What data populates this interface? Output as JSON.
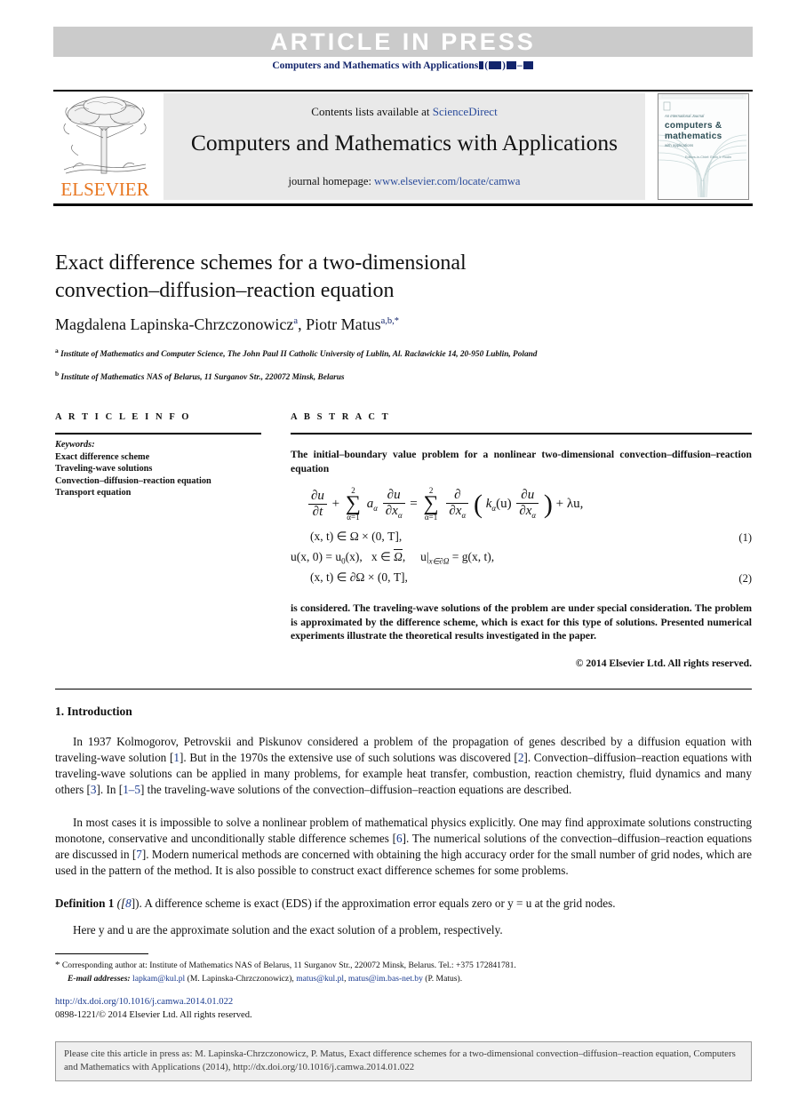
{
  "banner": {
    "text": "ARTICLE  IN  PRESS",
    "journal_ref_prefix": "Computers and Mathematics with Applications",
    "journal_ref_suffix": "( ) –"
  },
  "masthead": {
    "contents_prefix": "Contents lists available at ",
    "sciencedirect": "ScienceDirect",
    "journal_title": "Computers and Mathematics with Applications",
    "homepage_prefix": "journal homepage: ",
    "homepage_url": "www.elsevier.com/locate/camwa",
    "publisher": "ELSEVIER",
    "cover": {
      "line1": "An International Journal",
      "line2": "computers &",
      "line3": "mathematics",
      "line4": "with applications",
      "line5": "Editors-in-Chief: Ervin Y. Rodin"
    }
  },
  "article": {
    "title_line1": "Exact difference schemes for a two-dimensional",
    "title_line2": "convection–diffusion–reaction equation",
    "author1": "Magdalena Lapinska-Chrzczonowicz",
    "author1_sup": "a",
    "author2": "Piotr Matus",
    "author2_sup": "a,b,",
    "author2_star": "*",
    "affiliation_a_label": "a",
    "affiliation_a": "Institute of Mathematics and Computer Science, The John Paul II Catholic University of Lublin, Al. Raclawickie 14, 20-950 Lublin, Poland",
    "affiliation_b_label": "b",
    "affiliation_b": "Institute of Mathematics NAS of Belarus, 11 Surganov Str., 220072 Minsk, Belarus"
  },
  "info": {
    "heading": "A R T I C L E   I N F O",
    "keywords_label": "Keywords:",
    "keywords": [
      "Exact difference scheme",
      "Traveling-wave solutions",
      "Convection–diffusion–reaction equation",
      "Transport equation"
    ]
  },
  "abstract": {
    "heading": "A B S T R A C T",
    "intro": "The initial–boundary value problem for a nonlinear two-dimensional convection–diffusion–reaction equation",
    "tail": "is considered. The traveling-wave solutions of the problem are under special consideration. The problem is approximated by the difference scheme, which is exact for this type of solutions. Presented numerical experiments illustrate the theoretical results investigated in the paper.",
    "copyright": "© 2014 Elsevier Ltd. All rights reserved."
  },
  "equations": {
    "eq1_number": "(1)",
    "eq2_number": "(2)",
    "eq1_lhs_num": "∂u",
    "eq1_lhs_den": "∂t",
    "eq1_sum_upper": "2",
    "eq1_sum_lower": "α=1",
    "eq1_coeff": "a",
    "eq1_coeff_sub": "α",
    "eq1_du": "∂u",
    "eq1_dxa": "∂x",
    "eq1_dxa_sub": "α",
    "eq1_rhs_d": "∂",
    "eq1_k": "k",
    "eq1_k_sub": "α",
    "eq1_k_arg": "(u)",
    "eq1_lambda": "+ λu,",
    "eq1_domain": "(x, t) ∈ Ω × (0, T],",
    "eq2_init": "u(x, 0) = u",
    "eq2_init_sub": "0",
    "eq2_init_rest": "(x),",
    "eq2_xin": "x ∈",
    "eq2_omegabar": "Ω",
    "eq2_comma": ",",
    "eq2_bc": "u|",
    "eq2_bc_sub": "x∈∂Ω",
    "eq2_bc_rest": "= g(x, t),",
    "eq2_domain": "(x, t) ∈ ∂Ω × (0, T],"
  },
  "introduction": {
    "heading": "1. Introduction",
    "p1_a": "In 1937 Kolmogorov, Petrovskii and Piskunov considered a problem of the propagation of genes described by a diffusion equation with traveling-wave solution [",
    "p1_ref1": "1",
    "p1_b": "]. But in the 1970s the extensive use of such solutions was discovered [",
    "p1_ref2": "2",
    "p1_c": "]. Convection–diffusion–reaction equations with traveling-wave solutions can be applied in many problems, for example heat transfer, combustion, reaction chemistry, fluid dynamics and many others [",
    "p1_ref3": "3",
    "p1_d": "]. In [",
    "p1_ref4": "1–5",
    "p1_e": "] the traveling-wave solutions of the convection–diffusion–reaction equations are described.",
    "p2_a": "In most cases it is impossible to solve a nonlinear problem of mathematical physics explicitly. One may find approximate solutions constructing monotone, conservative and unconditionally stable difference schemes [",
    "p2_ref1": "6",
    "p2_b": "]. The numerical solutions of the convection–diffusion–reaction equations are discussed in [",
    "p2_ref2": "7",
    "p2_c": "]. Modern numerical methods are concerned with obtaining the high accuracy order for the small number of grid nodes, which are used in the pattern of the method. It is also possible to construct exact difference schemes for some problems.",
    "definition_label": "Definition 1",
    "definition_ref_open": " ([",
    "definition_ref": "8",
    "definition_ref_close": "]).",
    "definition_text": " A difference scheme is exact (EDS) if the approximation error equals zero or y = u at the grid nodes.",
    "definition_after": "Here y and u are the approximate solution and the exact solution of a problem, respectively."
  },
  "footnotes": {
    "star": "*",
    "corresponding": "Corresponding author at: Institute of Mathematics NAS of Belarus, 11 Surganov Str., 220072 Minsk, Belarus. Tel.: +375 172841781.",
    "email_label": "E-mail addresses:",
    "email1": "lapkam@kul.pl",
    "email1_owner": "(M. Lapinska-Chrzczonowicz),",
    "email2": "matus@kul.pl",
    "email2_sep": ",",
    "email3": "matus@im.bas-net.by",
    "email3_owner": "(P. Matus).",
    "doi": "http://dx.doi.org/10.1016/j.camwa.2014.01.022",
    "issn": "0898-1221/© 2014 Elsevier Ltd. All rights reserved."
  },
  "cite_box": {
    "text": "Please cite this article in press as: M. Lapinska-Chrzczonowicz, P. Matus, Exact difference schemes for a two-dimensional convection–diffusion–reaction equation, Computers and Mathematics with Applications (2014), http://dx.doi.org/10.1016/j.camwa.2014.01.022"
  },
  "colors": {
    "banner_bg": "#cbcbcb",
    "banner_text": "#ffffff",
    "navy": "#12246b",
    "link_blue": "#2a4b9b",
    "ref_blue": "#1a3a8f",
    "elsevier_orange": "#E87722",
    "grey_box": "#e9e9e9",
    "cite_box": "#efefef"
  }
}
